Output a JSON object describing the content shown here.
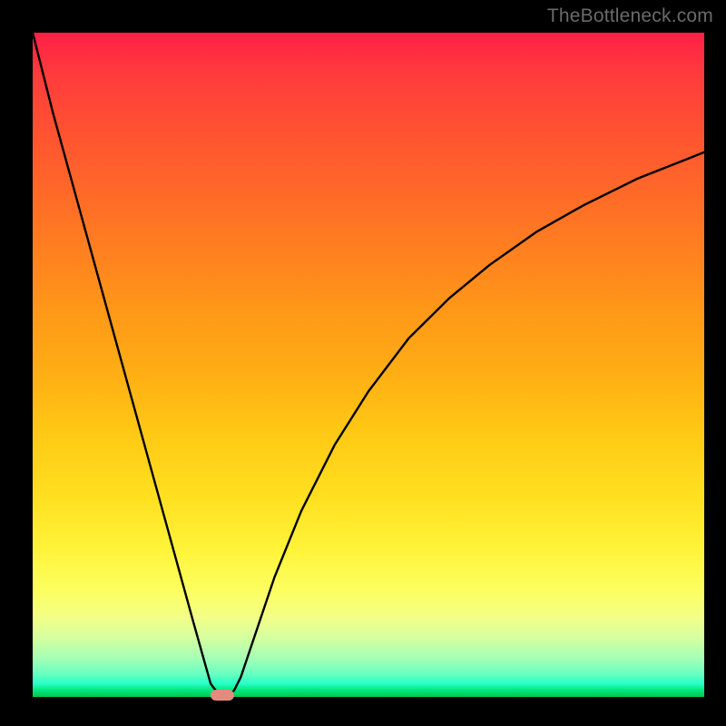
{
  "watermark": "TheBottleneck.com",
  "chart_data": {
    "type": "line",
    "title": "",
    "xlabel": "",
    "ylabel": "",
    "xlim": [
      0,
      100
    ],
    "ylim": [
      0,
      100
    ],
    "grid": false,
    "series": [
      {
        "name": "curve",
        "x": [
          0,
          3,
          6,
          9,
          12,
          15,
          18,
          21,
          24,
          26.5,
          28,
          29,
          30,
          31,
          33,
          36,
          40,
          45,
          50,
          56,
          62,
          68,
          75,
          82,
          90,
          100
        ],
        "y": [
          100,
          88,
          77,
          66,
          55,
          44,
          33,
          22,
          11,
          2,
          0,
          0,
          1,
          3,
          9,
          18,
          28,
          38,
          46,
          54,
          60,
          65,
          70,
          74,
          78,
          82
        ]
      }
    ],
    "marker": {
      "x": 28.3,
      "y": 0.3,
      "color": "#e48b7e"
    },
    "background_gradient": {
      "top": "#ff1f47",
      "bottom": "#00c852"
    }
  }
}
